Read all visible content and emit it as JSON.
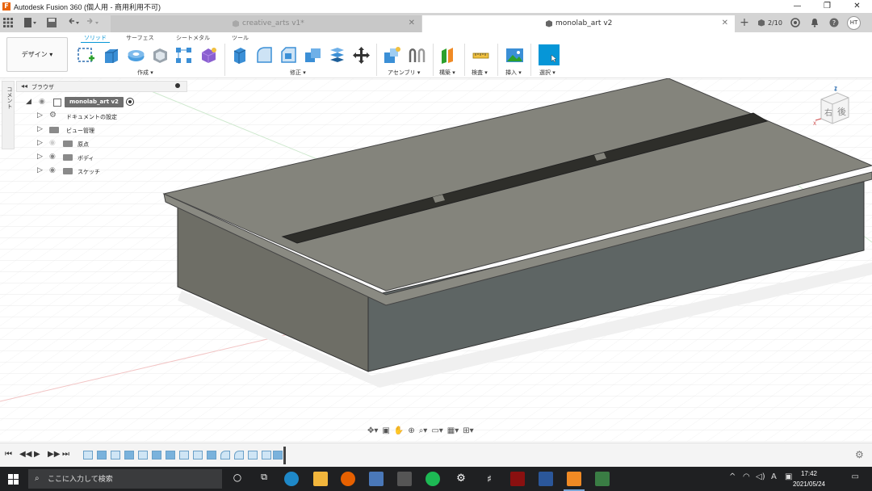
{
  "window": {
    "title": "Autodesk Fusion 360 (個人用 - 商用利用不可)",
    "logo_letter": "F",
    "minimize": "—",
    "maximize": "❐",
    "close": "✕"
  },
  "tabs": [
    {
      "label": "creative_arts v1*",
      "close": "✕",
      "active": false
    },
    {
      "label": "monolab_art v2",
      "close": "✕",
      "active": true
    }
  ],
  "tabbar_right": {
    "add": "+",
    "jobs": "2/10",
    "user_initials": "HT"
  },
  "toolbar": {
    "workspace": "デザイン ▾",
    "tabs": [
      "ソリッド",
      "サーフェス",
      "シートメタル",
      "ツール"
    ],
    "groups": [
      "作成 ▾",
      "修正 ▾",
      "アセンブリ ▾",
      "構築 ▾",
      "検査 ▾",
      "挿入 ▾",
      "選択 ▾"
    ]
  },
  "browser": {
    "side_label": "コメント",
    "header": "ブラウザ",
    "root": "monolab_art v2",
    "items": [
      {
        "label": "ドキュメントの設定"
      },
      {
        "label": "ビュー管理"
      },
      {
        "label": "原点"
      },
      {
        "label": "ボディ"
      },
      {
        "label": "スケッチ"
      }
    ]
  },
  "viewcube": {
    "face_right": "右",
    "face_back": "後",
    "axis_z": "Z",
    "axis_x": "X"
  },
  "taskbar": {
    "search_placeholder": "ここに入力して検索",
    "time": "17:42",
    "date": "2021/05/24",
    "ime": "A"
  },
  "colors": {
    "accent": "#0696d7",
    "model_top": "#84847c",
    "model_front": "#6e6e66",
    "model_right": "#5e6564",
    "taskbar": "#1f2022"
  }
}
